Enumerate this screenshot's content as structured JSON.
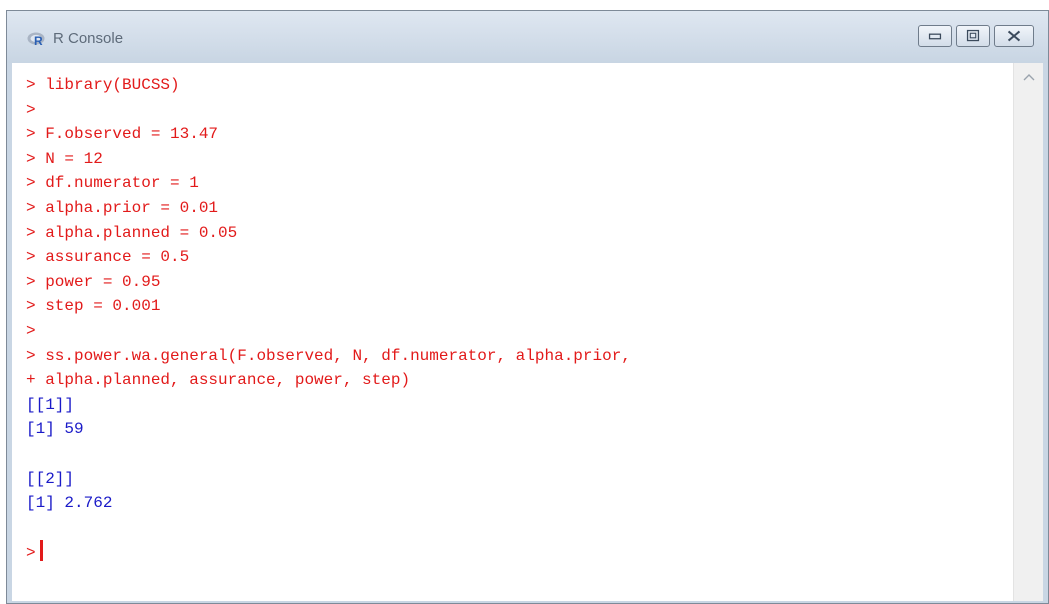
{
  "window": {
    "title": "R Console",
    "icon": "r-logo-icon",
    "controls": [
      "minimize-icon",
      "maximize-icon",
      "close-icon"
    ]
  },
  "colors": {
    "command_text": "#e21a1a",
    "output_text": "#1a1ac8"
  },
  "console": {
    "lines": [
      {
        "kind": "cmd",
        "text": "> library(BUCSS)"
      },
      {
        "kind": "cmd",
        "text": ">"
      },
      {
        "kind": "cmd",
        "text": "> F.observed = 13.47"
      },
      {
        "kind": "cmd",
        "text": "> N = 12"
      },
      {
        "kind": "cmd",
        "text": "> df.numerator = 1"
      },
      {
        "kind": "cmd",
        "text": "> alpha.prior = 0.01"
      },
      {
        "kind": "cmd",
        "text": "> alpha.planned = 0.05"
      },
      {
        "kind": "cmd",
        "text": "> assurance = 0.5"
      },
      {
        "kind": "cmd",
        "text": "> power = 0.95"
      },
      {
        "kind": "cmd",
        "text": "> step = 0.001"
      },
      {
        "kind": "cmd",
        "text": ">"
      },
      {
        "kind": "cmd",
        "text": "> ss.power.wa.general(F.observed, N, df.numerator, alpha.prior,"
      },
      {
        "kind": "cmd",
        "text": "+ alpha.planned, assurance, power, step)"
      },
      {
        "kind": "out",
        "text": "[[1]]"
      },
      {
        "kind": "out",
        "text": "[1] 59"
      },
      {
        "kind": "out",
        "text": ""
      },
      {
        "kind": "out",
        "text": "[[2]]"
      },
      {
        "kind": "out",
        "text": "[1] 2.762"
      },
      {
        "kind": "out",
        "text": ""
      }
    ],
    "prompt": ">"
  }
}
